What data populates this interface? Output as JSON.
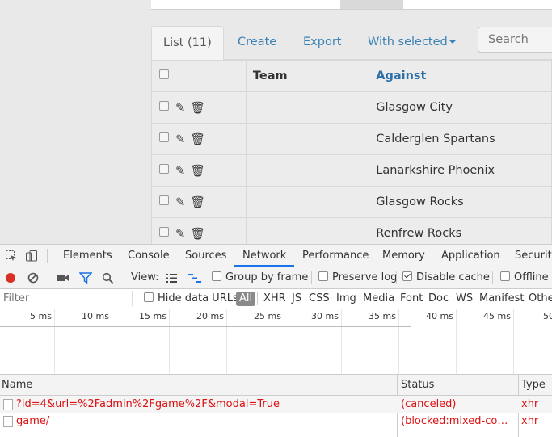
{
  "app": {
    "tabs": {
      "list": "List (11)",
      "create": "Create",
      "export": "Export",
      "with_selected": "With selected"
    },
    "search": {
      "placeholder": "Search"
    },
    "table": {
      "headers": {
        "team": "Team",
        "against": "Against"
      },
      "rows": [
        {
          "team": "",
          "against": "Glasgow City"
        },
        {
          "team": "",
          "against": "Calderglen Spartans"
        },
        {
          "team": "",
          "against": "Lanarkshire Phoenix"
        },
        {
          "team": "",
          "against": "Glasgow Rocks"
        },
        {
          "team": "",
          "against": "Renfrew Rocks"
        }
      ]
    }
  },
  "devtools": {
    "tabs": [
      "Elements",
      "Console",
      "Sources",
      "Network",
      "Performance",
      "Memory",
      "Application",
      "Security"
    ],
    "active_tab": "Network",
    "toolbar": {
      "view_label": "View:",
      "group_by_frame": "Group by frame",
      "preserve_log": "Preserve log",
      "disable_cache": "Disable cache",
      "offline": "Offline"
    },
    "filter": {
      "placeholder": "Filter",
      "hide_data_urls": "Hide data URLs",
      "types": [
        "All",
        "XHR",
        "JS",
        "CSS",
        "Img",
        "Media",
        "Font",
        "Doc",
        "WS",
        "Manifest",
        "Other"
      ]
    },
    "timeline_ticks": [
      "5 ms",
      "10 ms",
      "15 ms",
      "20 ms",
      "25 ms",
      "30 ms",
      "35 ms",
      "40 ms",
      "45 ms",
      "50"
    ],
    "columns": {
      "name": "Name",
      "status": "Status",
      "type": "Type"
    },
    "requests": [
      {
        "name": "?id=4&url=%2Fadmin%2Fgame%2F&modal=True",
        "status": "(canceled)",
        "type": "xhr"
      },
      {
        "name": "game/",
        "status": "(blocked:mixed-content)",
        "type": "xhr"
      }
    ],
    "colors": {
      "error_text": "#dd1111",
      "accent": "#1a73e8",
      "record": "#d93025"
    }
  }
}
